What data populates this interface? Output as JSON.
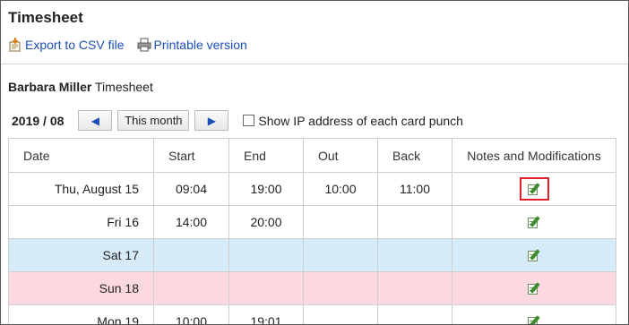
{
  "page": {
    "title": "Timesheet"
  },
  "actions": {
    "export_label": "Export to CSV file",
    "print_label": "Printable version"
  },
  "owner": {
    "name": "Barbara Miller",
    "suffix": " Timesheet"
  },
  "nav": {
    "period": "2019 / 08",
    "prev_icon": "◀",
    "this_month_label": "This month",
    "next_icon": "▶",
    "show_ip_label": "Show IP address of each card punch",
    "show_ip_checked": false
  },
  "table": {
    "columns": [
      "Date",
      "Start",
      "End",
      "Out",
      "Back",
      "Notes and Modifications"
    ],
    "rows": [
      {
        "date": "Thu, August 15",
        "start": "09:04",
        "end": "19:00",
        "out": "10:00",
        "back": "11:00",
        "type": "weekday"
      },
      {
        "date": "Fri 16",
        "start": "14:00",
        "end": "20:00",
        "out": "",
        "back": "",
        "type": "weekday"
      },
      {
        "date": "Sat 17",
        "start": "",
        "end": "",
        "out": "",
        "back": "",
        "type": "saturday"
      },
      {
        "date": "Sun 18",
        "start": "",
        "end": "",
        "out": "",
        "back": "",
        "type": "sunday"
      },
      {
        "date": "Mon 19",
        "start": "10:00",
        "end": "19:01",
        "out": "",
        "back": "",
        "type": "weekday"
      }
    ]
  },
  "colors": {
    "link": "#1a4fb8",
    "saturday_row": "#d6ecfb",
    "sunday_row": "#fcd9e0",
    "highlight_box": "#e0202a",
    "border": "#cfcfcf"
  },
  "icons": {
    "export": "export-csv-icon",
    "print": "printer-icon",
    "notes": "edit-notes-icon"
  }
}
